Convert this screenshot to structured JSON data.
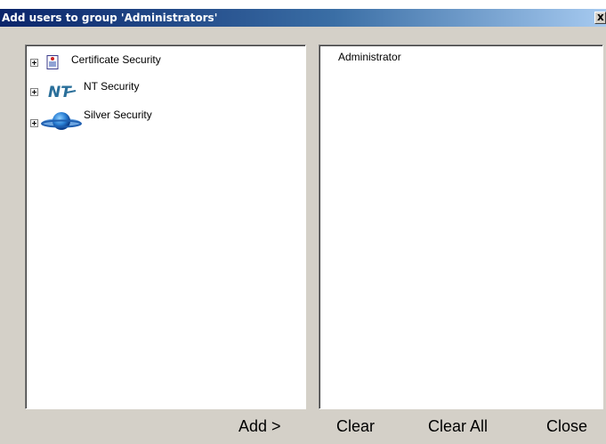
{
  "window": {
    "title": "Add users to group 'Administrators'",
    "close_glyph": "x"
  },
  "left_tree": {
    "nodes": [
      {
        "label": "Certificate Security",
        "icon": "certificate-icon"
      },
      {
        "label": "NT Security",
        "icon": "nt-logo-icon"
      },
      {
        "label": "Silver Security",
        "icon": "globe-icon"
      }
    ]
  },
  "right_list": {
    "items": [
      "Administrator"
    ]
  },
  "buttons": {
    "add": "Add >",
    "clear": "Clear",
    "clear_all": "Clear All",
    "close": "Close"
  },
  "colors": {
    "titlebar_start": "#0a246a",
    "titlebar_end": "#a6caf0",
    "window_face": "#d4d0c8"
  }
}
